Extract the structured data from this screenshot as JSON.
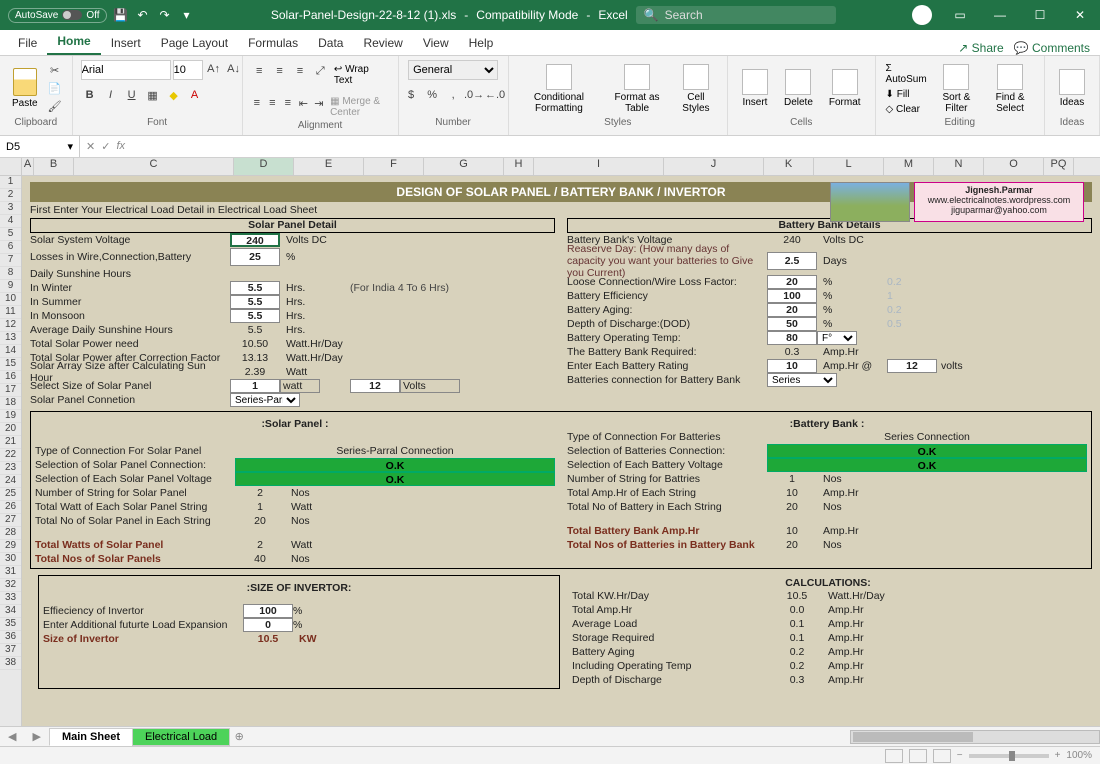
{
  "titlebar": {
    "autosave": "AutoSave",
    "autosave_state": "Off",
    "filename": "Solar-Panel-Design-22-8-12 (1).xls",
    "mode": "Compatibility Mode",
    "app": "Excel",
    "search_placeholder": "Search"
  },
  "tabs": [
    "File",
    "Home",
    "Insert",
    "Page Layout",
    "Formulas",
    "Data",
    "Review",
    "View",
    "Help"
  ],
  "ribbon_right": {
    "share": "Share",
    "comments": "Comments"
  },
  "ribbon": {
    "clipboard": "Clipboard",
    "paste": "Paste",
    "font_label": "Font",
    "font_name": "Arial",
    "font_size": "10",
    "alignment": "Alignment",
    "wrap": "Wrap Text",
    "merge": "Merge & Center",
    "number": "Number",
    "number_format": "General",
    "styles": "Styles",
    "cond": "Conditional Formatting",
    "fmt_table": "Format as Table",
    "cell_styles": "Cell Styles",
    "cells": "Cells",
    "insert": "Insert",
    "delete": "Delete",
    "format": "Format",
    "editing": "Editing",
    "autosum": "AutoSum",
    "fill": "Fill",
    "clear": "Clear",
    "sort": "Sort & Filter",
    "find": "Find & Select",
    "ideas": "Ideas"
  },
  "namebox": "D5",
  "columns": [
    "A",
    "B",
    "C",
    "D",
    "E",
    "F",
    "G",
    "H",
    "I",
    "J",
    "K",
    "L",
    "M",
    "N",
    "O",
    "PQ"
  ],
  "rows": [
    "1",
    "2",
    "3",
    "4",
    "5",
    "6",
    "7",
    "8",
    "9",
    "10",
    "11",
    "12",
    "13",
    "14",
    "15",
    "16",
    "17",
    "18",
    "19",
    "20",
    "21",
    "22",
    "23",
    "24",
    "25",
    "26",
    "27",
    "28",
    "29",
    "30",
    "31",
    "32",
    "33",
    "34",
    "35",
    "36",
    "37",
    "38"
  ],
  "banner": "DESIGN OF SOLAR PANEL / BATTERY BANK / INVERTOR",
  "info": {
    "l1": "Jignesh.Parmar",
    "l2": "www.electricalnotes.wordpress.com",
    "l3": "jiguparmar@yahoo.com"
  },
  "intro": "First Enter Your Electrical Load Detail in Electrical Load Sheet",
  "left": {
    "hdr": "Solar Panel Detail",
    "sys_v_lbl": "Solar System Voltage",
    "sys_v": "240",
    "sys_v_u": "Volts DC",
    "loss_lbl": "Losses in Wire,Connection,Battery",
    "loss": "25",
    "loss_u": "%",
    "sun_hdr": "Daily Sunshine Hours",
    "winter_lbl": "In Winter",
    "winter": "5.5",
    "hrs": "Hrs.",
    "hint": "(For India 4 To 6 Hrs)",
    "summer_lbl": "In Summer",
    "summer": "5.5",
    "monsoon_lbl": "In Monsoon",
    "monsoon": "5.5",
    "avg_lbl": "Average Daily Sunshine Hours",
    "avg": "5.5",
    "tpn_lbl": "Total Solar Power need",
    "tpn": "10.50",
    "whd": "Watt.Hr/Day",
    "tcf_lbl": "Total Solar Power after Correction Factor",
    "tcf": "13.13",
    "sash_lbl": "Solar Array Size after Calculating Sun Hour",
    "sash": "2.39",
    "watt": "Watt",
    "size_lbl": "Select Size of Solar Panel",
    "size": "1",
    "size_u": "watt",
    "size_v": "12",
    "size_vu": "Volts",
    "conn_lbl": "Solar Panel Connetion",
    "conn": "Series-Parral",
    "sp_hdr": ":Solar Panel :",
    "t1": "Type of Connection For Solar Panel",
    "t1v": "Series-Parral Connection",
    "t2": "Selection of Solar Panel Connection:",
    "ok": "O.K",
    "t3": "Selection of Each Solar Panel Voltage",
    "t4": "Number of String for Solar Panel",
    "t4v": "2",
    "nos": "Nos",
    "t5": "Total Watt of Each Solar Panel String",
    "t5v": "1",
    "t6": "Total No of Solar Panel in Each String",
    "t6v": "20",
    "t7": "Total Watts of Solar Panel",
    "t7v": "2",
    "t8": "Total Nos of Solar Panels",
    "t8v": "40",
    "inv_hdr": ":SIZE OF INVERTOR:",
    "eff_lbl": "Effieciency of Invertor",
    "eff": "100",
    "pct": "%",
    "exp_lbl": "Enter Additional futurte Load Expansion",
    "exp": "0",
    "soi_lbl": "Size of Invertor",
    "soi": "10.5",
    "kw": "KW"
  },
  "right": {
    "hdr": "Battery Bank Details",
    "bv_lbl": "Battery Bank's Voltage",
    "bv": "240",
    "bv_u": "Volts DC",
    "rd_lbl": "Reaserve Day: (How many days of capacity you want your batteries to Give you Current)",
    "rd": "2.5",
    "days": "Days",
    "lc_lbl": "Loose Connection/Wire Loss Factor:",
    "lc": "20",
    "pct": "%",
    "lc_g": "0.2",
    "be_lbl": "Battery Efficiency",
    "be": "100",
    "be_g": "1",
    "ba_lbl": "Battery Aging:",
    "ba": "20",
    "ba_g": "0.2",
    "dod_lbl": "Depth of Discharge:(DOD)",
    "dod": "50",
    "dod_g": "0.5",
    "bot_lbl": "Battery Operating Temp:",
    "bot": "80",
    "bot_u": "F°",
    "req_lbl": "The Battery Bank Required:",
    "req": "0.3",
    "amphr": "Amp.Hr",
    "ebr_lbl": "Enter Each Battery Rating",
    "ebr": "10",
    "ebr_at": "Amp.Hr @",
    "ebr_v": "12",
    "volts": "volts",
    "bc_lbl": "Batteries connection for Battery Bank",
    "bc": "Series",
    "bb_hdr": ":Battery Bank :",
    "b1": "Type of Connection For Batteries",
    "b1v": "Series Connection",
    "b2": "Selection of Batteries Connection:",
    "b3": "Selection of Each Battery Voltage",
    "b4": "Number of String for Battries",
    "b4v": "1",
    "b5": "Total Amp.Hr of Each String",
    "b5v": "10",
    "b6": "Total No of Battery in Each String",
    "b6v": "20",
    "b7": "Total Battery Bank Amp.Hr",
    "b7v": "10",
    "b8": "Total Nos of Batteries in Battery Bank",
    "b8v": "20",
    "calc_hdr": "CALCULATIONS:",
    "c1": "Total KW.Hr/Day",
    "c1v": "10.5",
    "c1u": "Watt.Hr/Day",
    "c2": "Total Amp.Hr",
    "c2v": "0.0",
    "c3": "Average Load",
    "c3v": "0.1",
    "c4": "Storage Required",
    "c4v": "0.1",
    "c5": "Battery Aging",
    "c5v": "0.2",
    "c6": "Including Operating Temp",
    "c6v": "0.2",
    "c7": "Depth of Discharge",
    "c7v": "0.3"
  },
  "sheets": {
    "main": "Main Sheet",
    "load": "Electrical Load"
  },
  "zoom": "100%"
}
